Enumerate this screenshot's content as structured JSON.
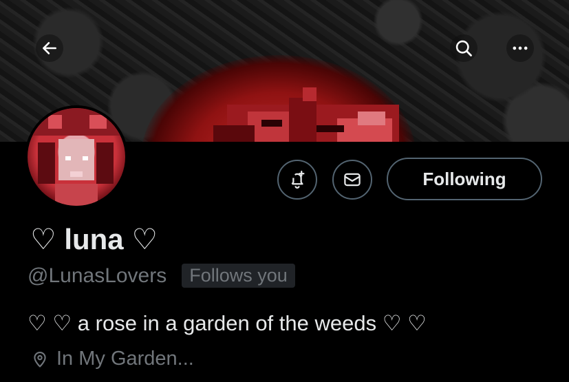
{
  "header": {
    "back_icon": "arrow-left-icon",
    "search_icon": "search-icon",
    "more_icon": "more-horizontal-icon"
  },
  "profile": {
    "display_name": "♡ luna ♡",
    "handle": "@LunasLovers",
    "follows_you": "Follows you",
    "bio": "♡ ♡ a rose in a garden of the weeds ♡ ♡",
    "location": "In My Garden..."
  },
  "actions": {
    "notify_icon": "bell-plus-icon",
    "message_icon": "envelope-icon",
    "following_label": "Following"
  },
  "colors": {
    "background": "#000000",
    "primary_text": "#e7e9ea",
    "secondary_text": "#71767b",
    "button_border": "#536471",
    "badge_bg": "#202327",
    "banner_accent": "#c42a2a"
  }
}
